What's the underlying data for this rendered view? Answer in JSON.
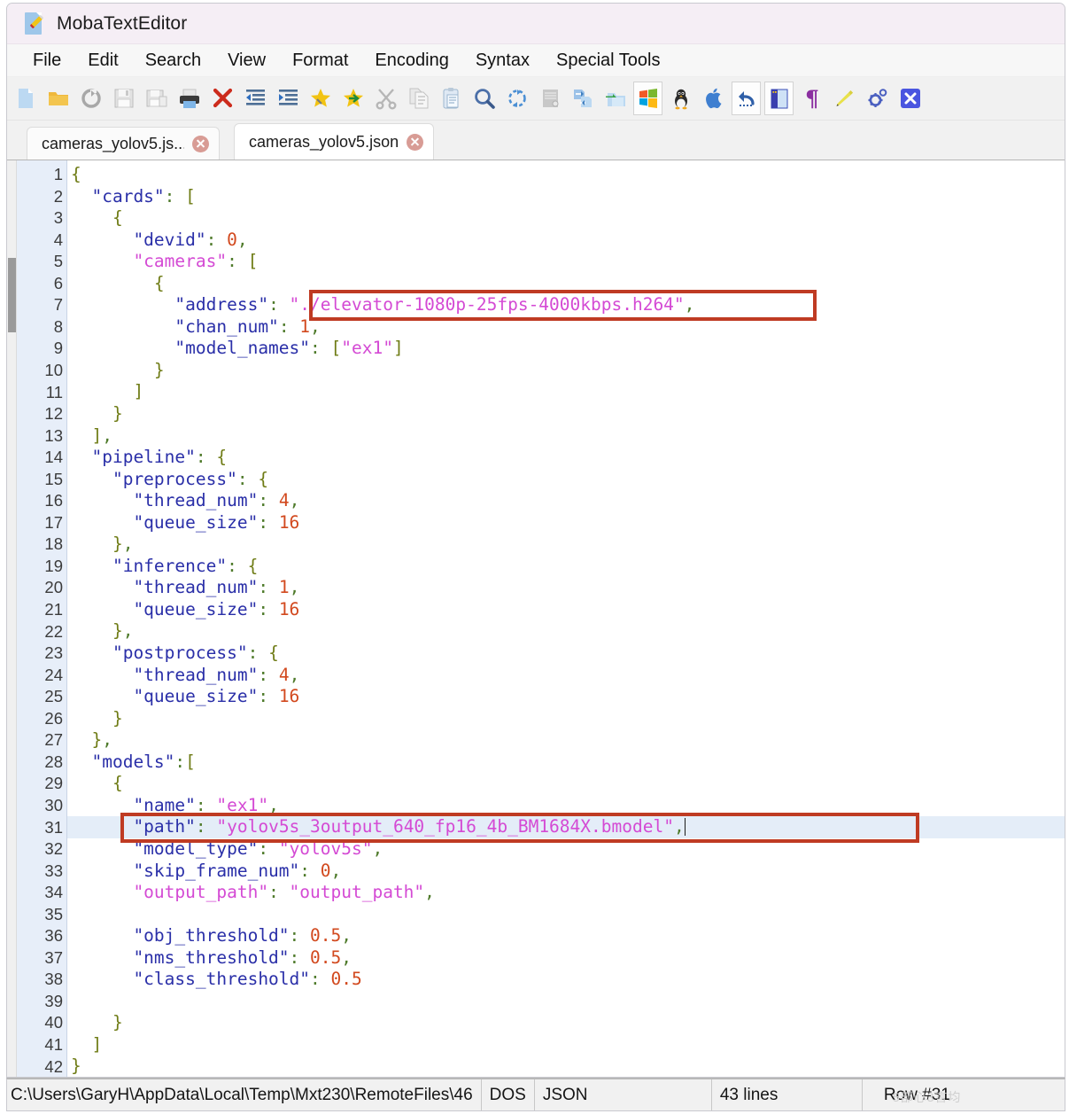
{
  "window": {
    "title": "MobaTextEditor",
    "title_icon": "document-pencil-icon"
  },
  "menubar": {
    "items": [
      {
        "label": "File",
        "name": "menu-file"
      },
      {
        "label": "Edit",
        "name": "menu-edit"
      },
      {
        "label": "Search",
        "name": "menu-search"
      },
      {
        "label": "View",
        "name": "menu-view"
      },
      {
        "label": "Format",
        "name": "menu-format"
      },
      {
        "label": "Encoding",
        "name": "menu-encoding"
      },
      {
        "label": "Syntax",
        "name": "menu-syntax"
      },
      {
        "label": "Special Tools",
        "name": "menu-special-tools"
      }
    ]
  },
  "toolbar": {
    "items": [
      {
        "icon": "new-file-icon",
        "framed": false
      },
      {
        "icon": "open-folder-icon",
        "framed": false
      },
      {
        "icon": "reload-icon",
        "framed": false
      },
      {
        "icon": "save-icon",
        "framed": false
      },
      {
        "icon": "save-as-icon",
        "framed": false
      },
      {
        "icon": "print-icon",
        "framed": false
      },
      {
        "icon": "close-x-icon",
        "framed": false
      },
      {
        "icon": "outdent-icon",
        "framed": false
      },
      {
        "icon": "indent-icon",
        "framed": false
      },
      {
        "icon": "bookmark-star-icon",
        "framed": false
      },
      {
        "icon": "next-bookmark-star-icon",
        "framed": false
      },
      {
        "icon": "cut-scissors-icon",
        "framed": false
      },
      {
        "icon": "copy-icon",
        "framed": false
      },
      {
        "icon": "paste-icon",
        "framed": false
      },
      {
        "icon": "search-magnifier-icon",
        "framed": false
      },
      {
        "icon": "replace-icon",
        "framed": false
      },
      {
        "icon": "document-properties-icon",
        "framed": false
      },
      {
        "icon": "swap-documents-icon",
        "framed": false
      },
      {
        "icon": "move-to-folder-icon",
        "framed": false
      },
      {
        "icon": "windows-logo-icon",
        "framed": true
      },
      {
        "icon": "linux-penguin-icon",
        "framed": false
      },
      {
        "icon": "apple-logo-icon",
        "framed": false
      },
      {
        "icon": "undo-icon",
        "framed": true
      },
      {
        "icon": "side-panel-icon",
        "framed": true
      },
      {
        "icon": "pilcrow-icon",
        "framed": false
      },
      {
        "icon": "highlighter-pencil-icon",
        "framed": false
      },
      {
        "icon": "settings-gear-icon",
        "framed": false
      },
      {
        "icon": "exit-x-button-icon",
        "framed": false
      }
    ]
  },
  "tabs": [
    {
      "label": "cameras_yolov5.js...",
      "active": false,
      "name": "tab-cameras-yolov5-js"
    },
    {
      "label": "cameras_yolov5.json",
      "active": true,
      "name": "tab-cameras-yolov5-json"
    }
  ],
  "editor": {
    "current_line": 31,
    "total_numbered_lines": 42,
    "lines": [
      {
        "n": 1,
        "tokens": [
          {
            "t": "{",
            "c": "pun"
          }
        ]
      },
      {
        "n": 2,
        "tokens": [
          {
            "t": "  \"cards\"",
            "c": "k"
          },
          {
            "t": ": ",
            "c": "col"
          },
          {
            "t": "[",
            "c": "pun"
          }
        ]
      },
      {
        "n": 3,
        "tokens": [
          {
            "t": "    {",
            "c": "pun"
          }
        ]
      },
      {
        "n": 4,
        "tokens": [
          {
            "t": "      \"devid\"",
            "c": "k"
          },
          {
            "t": ": ",
            "c": "col"
          },
          {
            "t": "0",
            "c": "num"
          },
          {
            "t": ",",
            "c": "col"
          }
        ]
      },
      {
        "n": 5,
        "tokens": [
          {
            "t": "      \"cameras\"",
            "c": "km"
          },
          {
            "t": ": ",
            "c": "col"
          },
          {
            "t": "[",
            "c": "pun"
          }
        ]
      },
      {
        "n": 6,
        "tokens": [
          {
            "t": "        {",
            "c": "pun"
          }
        ]
      },
      {
        "n": 7,
        "tokens": [
          {
            "t": "          \"address\"",
            "c": "k"
          },
          {
            "t": ": ",
            "c": "col"
          },
          {
            "t": "\"./elevator-1080p-25fps-4000kbps.h264\"",
            "c": "str"
          },
          {
            "t": ",",
            "c": "col"
          }
        ]
      },
      {
        "n": 8,
        "tokens": [
          {
            "t": "          \"chan_num\"",
            "c": "k"
          },
          {
            "t": ": ",
            "c": "col"
          },
          {
            "t": "1",
            "c": "num"
          },
          {
            "t": ",",
            "c": "col"
          }
        ]
      },
      {
        "n": 9,
        "tokens": [
          {
            "t": "          \"model_names\"",
            "c": "k"
          },
          {
            "t": ": ",
            "c": "col"
          },
          {
            "t": "[",
            "c": "pun"
          },
          {
            "t": "\"ex1\"",
            "c": "str"
          },
          {
            "t": "]",
            "c": "pun"
          }
        ]
      },
      {
        "n": 10,
        "tokens": [
          {
            "t": "        }",
            "c": "pun"
          }
        ]
      },
      {
        "n": 11,
        "tokens": [
          {
            "t": "      ]",
            "c": "pun"
          }
        ]
      },
      {
        "n": 12,
        "tokens": [
          {
            "t": "    }",
            "c": "pun"
          }
        ]
      },
      {
        "n": 13,
        "tokens": [
          {
            "t": "  ]",
            "c": "pun"
          },
          {
            "t": ",",
            "c": "col"
          }
        ]
      },
      {
        "n": 14,
        "tokens": [
          {
            "t": "  \"pipeline\"",
            "c": "k"
          },
          {
            "t": ": ",
            "c": "col"
          },
          {
            "t": "{",
            "c": "pun"
          }
        ]
      },
      {
        "n": 15,
        "tokens": [
          {
            "t": "    \"preprocess\"",
            "c": "k"
          },
          {
            "t": ": ",
            "c": "col"
          },
          {
            "t": "{",
            "c": "pun"
          }
        ]
      },
      {
        "n": 16,
        "tokens": [
          {
            "t": "      \"thread_num\"",
            "c": "k"
          },
          {
            "t": ": ",
            "c": "col"
          },
          {
            "t": "4",
            "c": "num"
          },
          {
            "t": ",",
            "c": "col"
          }
        ]
      },
      {
        "n": 17,
        "tokens": [
          {
            "t": "      \"queue_size\"",
            "c": "k"
          },
          {
            "t": ": ",
            "c": "col"
          },
          {
            "t": "16",
            "c": "num"
          }
        ]
      },
      {
        "n": 18,
        "tokens": [
          {
            "t": "    }",
            "c": "pun"
          },
          {
            "t": ",",
            "c": "col"
          }
        ]
      },
      {
        "n": 19,
        "tokens": [
          {
            "t": "    \"inference\"",
            "c": "k"
          },
          {
            "t": ": ",
            "c": "col"
          },
          {
            "t": "{",
            "c": "pun"
          }
        ]
      },
      {
        "n": 20,
        "tokens": [
          {
            "t": "      \"thread_num\"",
            "c": "k"
          },
          {
            "t": ": ",
            "c": "col"
          },
          {
            "t": "1",
            "c": "num"
          },
          {
            "t": ",",
            "c": "col"
          }
        ]
      },
      {
        "n": 21,
        "tokens": [
          {
            "t": "      \"queue_size\"",
            "c": "k"
          },
          {
            "t": ": ",
            "c": "col"
          },
          {
            "t": "16",
            "c": "num"
          }
        ]
      },
      {
        "n": 22,
        "tokens": [
          {
            "t": "    }",
            "c": "pun"
          },
          {
            "t": ",",
            "c": "col"
          }
        ]
      },
      {
        "n": 23,
        "tokens": [
          {
            "t": "    \"postprocess\"",
            "c": "k"
          },
          {
            "t": ": ",
            "c": "col"
          },
          {
            "t": "{",
            "c": "pun"
          }
        ]
      },
      {
        "n": 24,
        "tokens": [
          {
            "t": "      \"thread_num\"",
            "c": "k"
          },
          {
            "t": ": ",
            "c": "col"
          },
          {
            "t": "4",
            "c": "num"
          },
          {
            "t": ",",
            "c": "col"
          }
        ]
      },
      {
        "n": 25,
        "tokens": [
          {
            "t": "      \"queue_size\"",
            "c": "k"
          },
          {
            "t": ": ",
            "c": "col"
          },
          {
            "t": "16",
            "c": "num"
          }
        ]
      },
      {
        "n": 26,
        "tokens": [
          {
            "t": "    }",
            "c": "pun"
          }
        ]
      },
      {
        "n": 27,
        "tokens": [
          {
            "t": "  }",
            "c": "pun"
          },
          {
            "t": ",",
            "c": "col"
          }
        ]
      },
      {
        "n": 28,
        "tokens": [
          {
            "t": "  \"models\"",
            "c": "k"
          },
          {
            "t": ":",
            "c": "col"
          },
          {
            "t": "[",
            "c": "pun"
          }
        ]
      },
      {
        "n": 29,
        "tokens": [
          {
            "t": "    {",
            "c": "pun"
          }
        ]
      },
      {
        "n": 30,
        "tokens": [
          {
            "t": "      \"name\"",
            "c": "k"
          },
          {
            "t": ": ",
            "c": "col"
          },
          {
            "t": "\"ex1\"",
            "c": "str"
          },
          {
            "t": ",",
            "c": "col"
          }
        ]
      },
      {
        "n": 31,
        "current": true,
        "cursor": true,
        "tokens": [
          {
            "t": "      \"path\"",
            "c": "k"
          },
          {
            "t": ": ",
            "c": "col"
          },
          {
            "t": "\"yolov5s_3output_640_fp16_4b_BM1684X.bmodel\"",
            "c": "str"
          },
          {
            "t": ",",
            "c": "col"
          }
        ]
      },
      {
        "n": 32,
        "tokens": [
          {
            "t": "      \"model_type\"",
            "c": "k"
          },
          {
            "t": ": ",
            "c": "col"
          },
          {
            "t": "\"yolov5s\"",
            "c": "str"
          },
          {
            "t": ",",
            "c": "col"
          }
        ]
      },
      {
        "n": 33,
        "tokens": [
          {
            "t": "      \"skip_frame_num\"",
            "c": "k"
          },
          {
            "t": ": ",
            "c": "col"
          },
          {
            "t": "0",
            "c": "num"
          },
          {
            "t": ",",
            "c": "col"
          }
        ]
      },
      {
        "n": 34,
        "tokens": [
          {
            "t": "      \"output_path\"",
            "c": "km"
          },
          {
            "t": ": ",
            "c": "col"
          },
          {
            "t": "\"output_path\"",
            "c": "str"
          },
          {
            "t": ",",
            "c": "col"
          }
        ]
      },
      {
        "n": 35,
        "tokens": []
      },
      {
        "n": 36,
        "tokens": [
          {
            "t": "      \"obj_threshold\"",
            "c": "k"
          },
          {
            "t": ": ",
            "c": "col"
          },
          {
            "t": "0.5",
            "c": "num"
          },
          {
            "t": ",",
            "c": "col"
          }
        ]
      },
      {
        "n": 37,
        "tokens": [
          {
            "t": "      \"nms_threshold\"",
            "c": "k"
          },
          {
            "t": ": ",
            "c": "col"
          },
          {
            "t": "0.5",
            "c": "num"
          },
          {
            "t": ",",
            "c": "col"
          }
        ]
      },
      {
        "n": 38,
        "tokens": [
          {
            "t": "      \"class_threshold\"",
            "c": "k"
          },
          {
            "t": ": ",
            "c": "col"
          },
          {
            "t": "0.5",
            "c": "num"
          }
        ]
      },
      {
        "n": 39,
        "tokens": []
      },
      {
        "n": 40,
        "tokens": [
          {
            "t": "    }",
            "c": "pun"
          }
        ]
      },
      {
        "n": 41,
        "tokens": [
          {
            "t": "  ]",
            "c": "pun"
          }
        ]
      },
      {
        "n": 42,
        "tokens": [
          {
            "t": "}",
            "c": "pun"
          }
        ]
      }
    ],
    "annotations": [
      {
        "name": "highlight-box-address",
        "line": 7,
        "label": "address-value-box"
      },
      {
        "name": "highlight-box-path",
        "line": 31,
        "label": "path-value-box"
      }
    ],
    "annotation_color": "#bf3b23"
  },
  "statusbar": {
    "file_path": "C:\\Users\\GaryH\\AppData\\Local\\Temp\\Mxt230\\RemoteFiles\\46",
    "line_endings": "DOS",
    "language": "JSON",
    "line_count": "43 lines",
    "row": "Row #31",
    "watermark": "5部心3言均"
  }
}
